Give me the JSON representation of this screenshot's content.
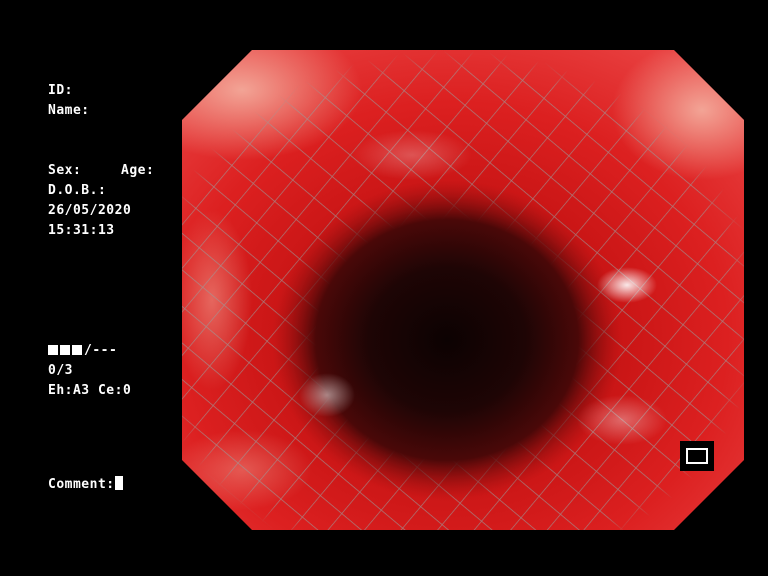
{
  "osd": {
    "id_label": "ID:",
    "name_label": "Name:",
    "sex_label": "Sex:",
    "age_label": "Age:",
    "dob_label": "D.O.B.:",
    "date": "26/05/2020",
    "time": "15:31:13",
    "indicator_suffix": "/---",
    "counter": "0/3",
    "settings": "Eh:A3 Ce:0",
    "comment_label": "Comment:"
  },
  "colors": {
    "background": "#000000",
    "tissue": "#d81818",
    "lumen": "#1a0505",
    "mesh": "#8a8a8a"
  },
  "icons": {
    "frame": "frame-icon"
  }
}
